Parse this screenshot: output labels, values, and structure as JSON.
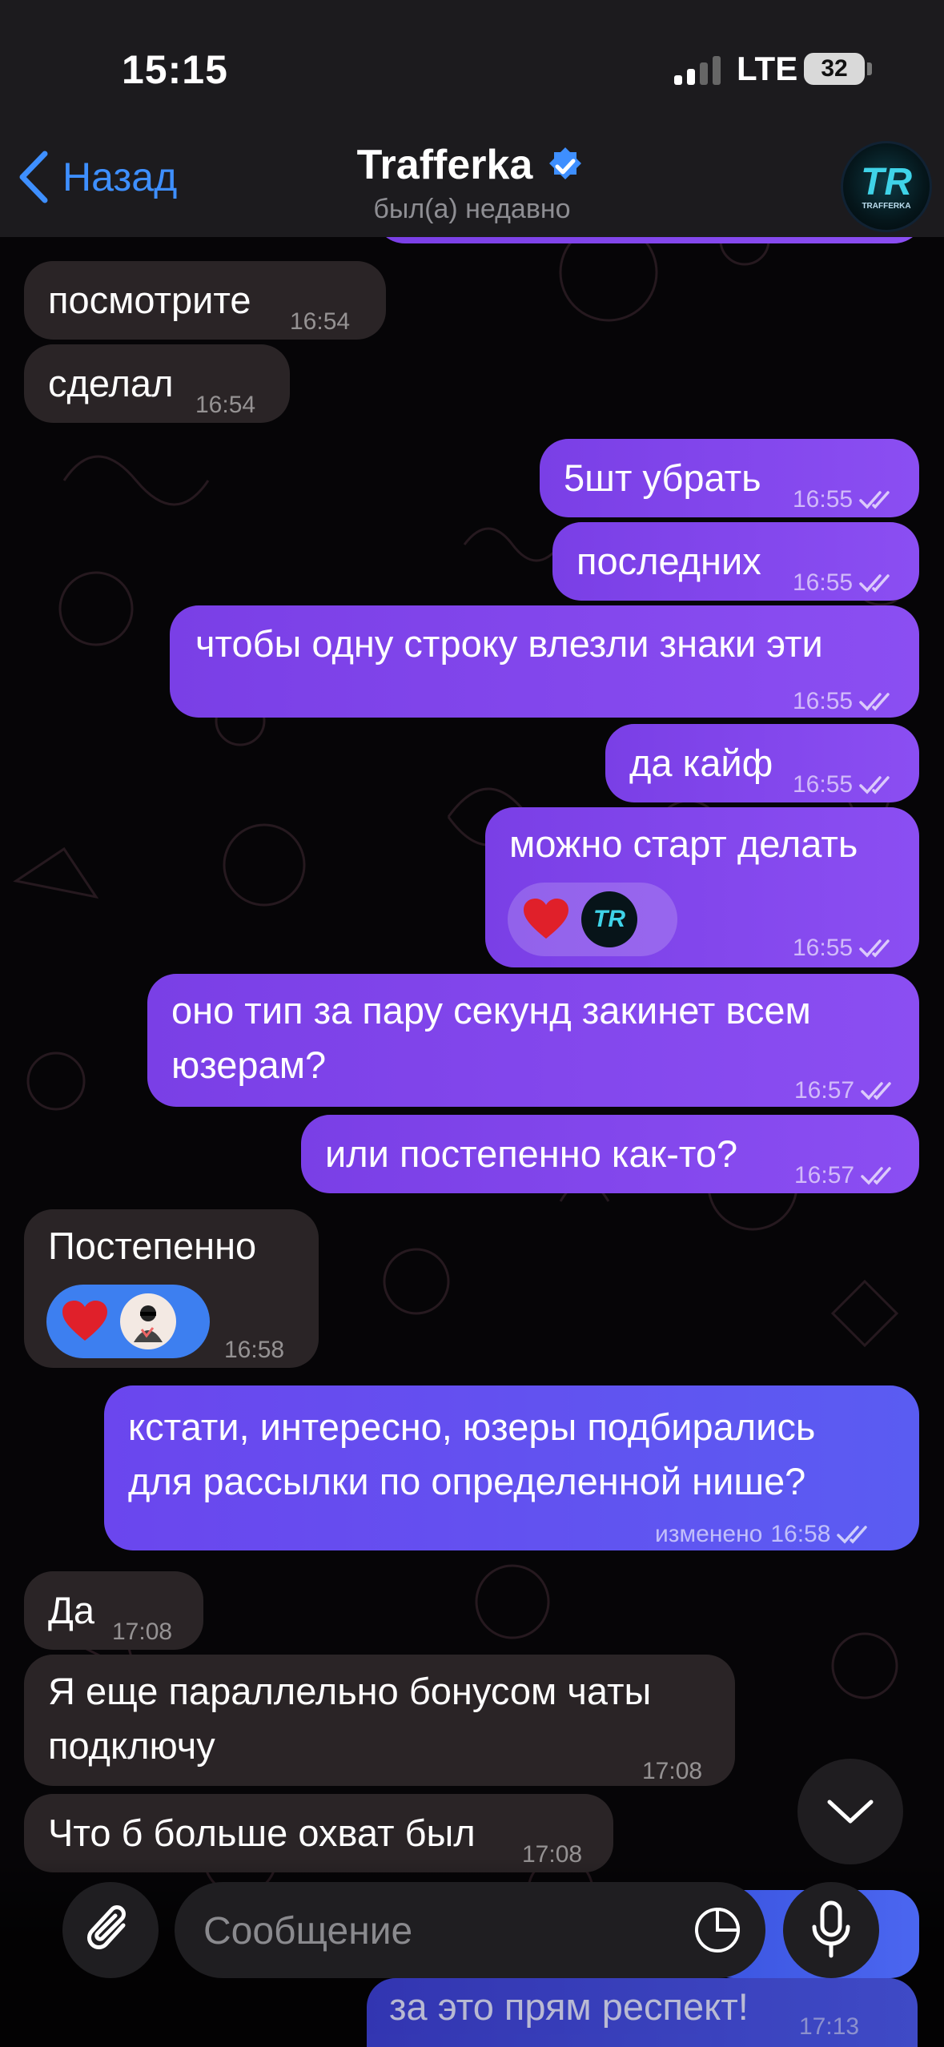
{
  "status_bar": {
    "time": "15:15",
    "network": "LTE",
    "battery": "32"
  },
  "header": {
    "back_label": "Назад",
    "title": "Trafferka",
    "status": "был(а) недавно",
    "avatar_text": "TR",
    "avatar_sub": "TRAFFERKA"
  },
  "messages": [
    {
      "dir": "in",
      "text": "посмотрите",
      "time": "16:54"
    },
    {
      "dir": "in",
      "text": "сделал",
      "time": "16:54"
    },
    {
      "dir": "out",
      "text": "5шт убрать",
      "time": "16:55"
    },
    {
      "dir": "out",
      "text": "последних",
      "time": "16:55"
    },
    {
      "dir": "out",
      "text": "чтобы одну строку влезли знаки эти",
      "time": "16:55"
    },
    {
      "dir": "out",
      "text": "да кайф",
      "time": "16:55"
    },
    {
      "dir": "out",
      "text": "можно старт делать",
      "time": "16:55",
      "reaction": "heart"
    },
    {
      "dir": "out",
      "line1": "оно тип за пару секунд закинет всем",
      "line2": "юзерам?",
      "time": "16:57"
    },
    {
      "dir": "out",
      "text": "или постепенно как-то?",
      "time": "16:57"
    },
    {
      "dir": "in",
      "text": "Постепенно",
      "time": "16:58",
      "reaction": "heart"
    },
    {
      "dir": "out",
      "line1": "кстати, интересно, юзеры подбирались",
      "line2": "для рассылки по определенной нише?",
      "edited": "изменено",
      "time": "16:58"
    },
    {
      "dir": "in",
      "text": "Да",
      "time": "17:08"
    },
    {
      "dir": "in",
      "line1": "Я еще параллельно бонусом чаты",
      "line2": "подключу",
      "time": "17:08"
    },
    {
      "dir": "in",
      "text": "Что б больше охват был",
      "time": "17:08"
    },
    {
      "dir": "out",
      "text": "за это прям респект!",
      "time": "17:13"
    }
  ],
  "composer": {
    "placeholder": "Сообщение"
  },
  "icons": {
    "back": "chevron-left-icon",
    "verified": "verified-badge-icon",
    "attach": "paperclip-icon",
    "sticker": "sticker-icon",
    "mic": "microphone-icon",
    "scroll": "chevron-down-icon",
    "reaction": "heart-icon"
  },
  "colors": {
    "accent": "#3e8fff",
    "outgoing_bubble": "#8b4ef2",
    "incoming_bubble": "#2a2426",
    "reaction_heart": "#e0202a"
  }
}
